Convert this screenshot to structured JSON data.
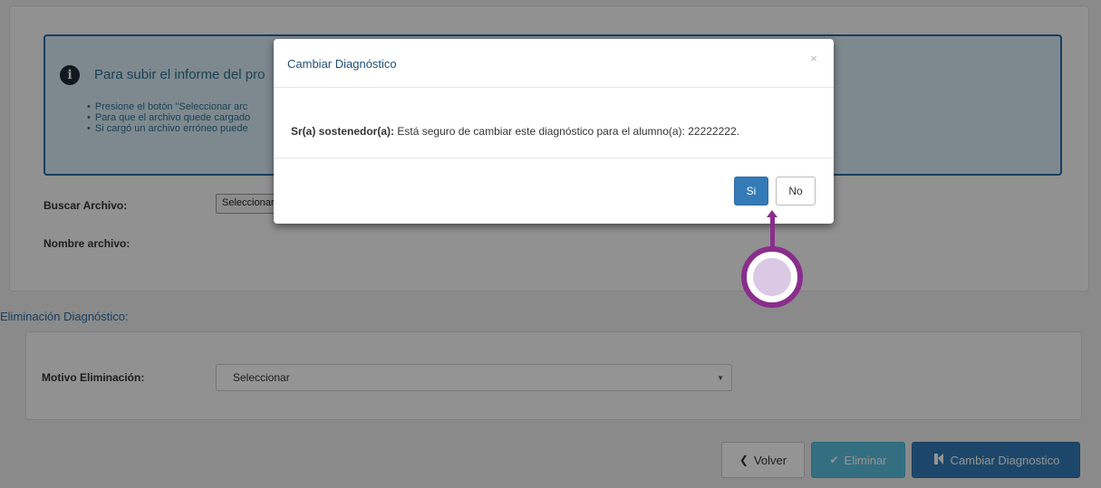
{
  "info": {
    "title": "Para subir el informe del pro",
    "bullets": [
      "Presione el botón \"Seleccionar arc",
      "Para que el archivo quede cargado",
      "Si cargó un archivo erróneo puede"
    ]
  },
  "form": {
    "buscar_label": "Buscar Archivo:",
    "file_button_label": "Seleccionar",
    "nombre_label": "Nombre archivo:"
  },
  "elimination": {
    "section_title": "Eliminación Diagnóstico:",
    "motivo_label": "Motivo Eliminación:",
    "select_value": "Seleccionar"
  },
  "actions": {
    "volver": "Volver",
    "eliminar": "Eliminar",
    "cambiar": "Cambiar Diagnostico"
  },
  "modal": {
    "title": "Cambiar Diagnóstico",
    "close_glyph": "×",
    "message_prefix": "Sr(a) sostenedor(a):",
    "message_text": "Está seguro de cambiar este diagnóstico para el alumno(a):",
    "student_id": "22222222.",
    "yes_label": "Si",
    "no_label": "No"
  },
  "colors": {
    "primary": "#337ab7",
    "info": "#5bc0de",
    "annotation": "#8a2d8c"
  }
}
